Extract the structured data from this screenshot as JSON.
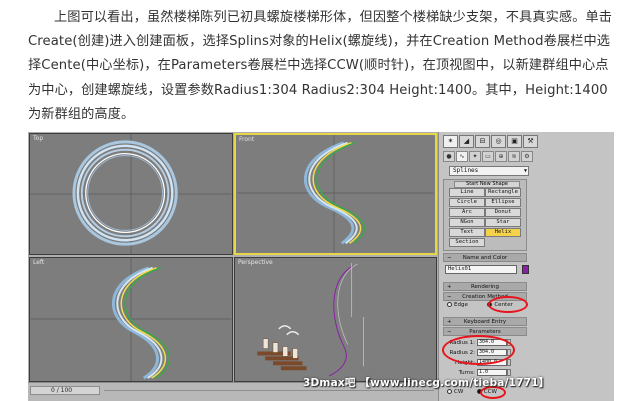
{
  "article": {
    "paragraph": "上图可以看出，虽然楼梯陈列已初具螺旋楼梯形体，但因整个楼梯缺少支架，不具真实感。单击Create(创建)进入创建面板，选择Splins对象的Helix(螺旋线)，并在Creation Method卷展栏中选择Cente(中心坐标)，在Parameters卷展栏中选择CCW(顺时针)，在顶视图中，以新建群组中心点为中心，创建螺旋线，设置参数Radius1:304 Radius2:304 Height:1400。其中，Height:1400为新群组的高度。"
  },
  "viewports": {
    "top_left_label": "Top",
    "top_right_label": "Front",
    "bottom_left_label": "Left",
    "bottom_right_label": "Perspective"
  },
  "time_slider": {
    "position": "0 / 100"
  },
  "command_panel": {
    "category_dropdown": "Splines",
    "object_type_header": "Start New Shape",
    "object_buttons": [
      "Line",
      "Rectangle",
      "Circle",
      "Ellipse",
      "Arc",
      "Donut",
      "NGon",
      "Star",
      "Text",
      "Helix",
      "Section"
    ],
    "selected_object": "Helix",
    "name_color_title": "Name and Color",
    "object_name": "Helix01",
    "object_color": "#8a1fa8",
    "rendering_title": "Rendering",
    "creation_method_title": "Creation Method",
    "creation_options": [
      "Edge",
      "Center"
    ],
    "creation_selected": "Center",
    "keyboard_entry_title": "Keyboard Entry",
    "parameters_title": "Parameters",
    "params": [
      {
        "label": "Radius 1:",
        "value": "304.0"
      },
      {
        "label": "Radius 2:",
        "value": "304.0"
      },
      {
        "label": "Height:",
        "value": "1400.0"
      },
      {
        "label": "Turns:",
        "value": "1.0"
      }
    ],
    "direction_options": [
      "CW",
      "CCW"
    ],
    "direction_selected": "CCW"
  },
  "watermark": "3Dmax吧 【www.linecg.com/tieba/1771】",
  "colors": {
    "highlight_ring": "#e8141a",
    "active_viewport": "#e8d64a",
    "selected_button": "#f4d24a"
  }
}
